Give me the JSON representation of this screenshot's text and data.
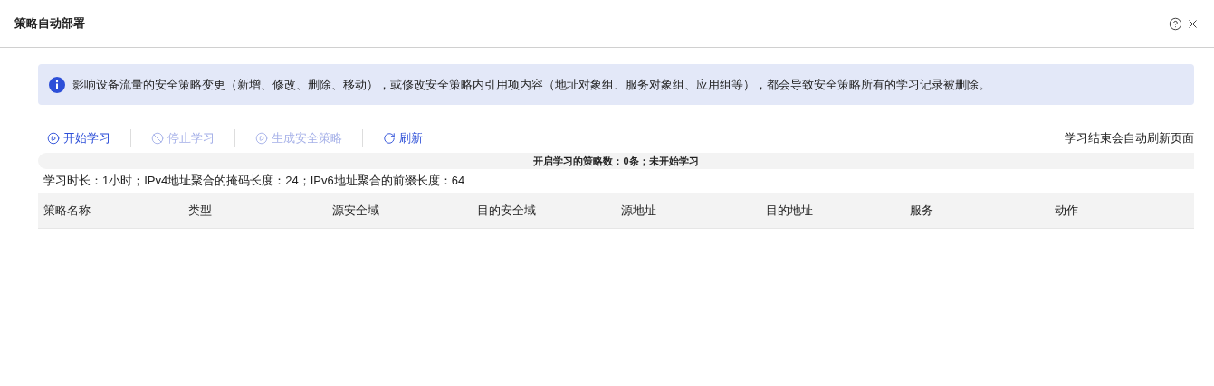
{
  "window": {
    "title": "策略自动部署"
  },
  "notice": {
    "text": "影响设备流量的安全策略变更（新增、修改、删除、移动），或修改安全策略内引用项内容（地址对象组、服务对象组、应用组等），都会导致安全策略所有的学习记录被删除。"
  },
  "toolbar": {
    "buttons": [
      {
        "kind": "start",
        "label": "开始学习",
        "disabled": false
      },
      {
        "kind": "stop",
        "label": "停止学习",
        "disabled": true
      },
      {
        "kind": "generate",
        "label": "生成安全策略",
        "disabled": true
      },
      {
        "kind": "refresh",
        "label": "刷新",
        "disabled": false
      }
    ],
    "hint": "学习结束会自动刷新页面"
  },
  "status": "开启学习的策略数：0条；未开始学习",
  "settings": "学习时长：1小时；IPv4地址聚合的掩码长度：24；IPv6地址聚合的前缀长度：64",
  "table": {
    "columns": [
      "策略名称",
      "类型",
      "源安全域",
      "目的安全域",
      "源地址",
      "目的地址",
      "服务",
      "动作"
    ]
  }
}
